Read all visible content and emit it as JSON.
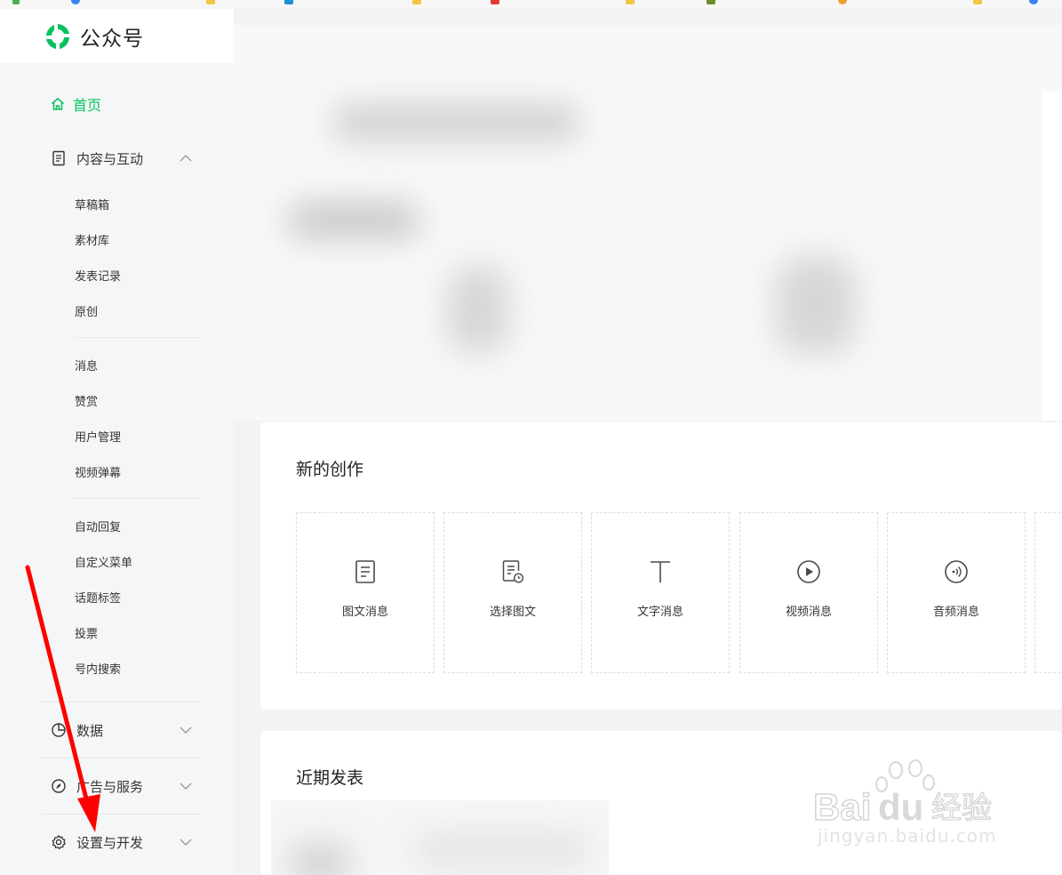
{
  "logo": {
    "text": "公众号",
    "brand_color": "#07c160"
  },
  "sidebar": {
    "home": {
      "label": "首页",
      "icon": "home-icon"
    },
    "content_group": {
      "label": "内容与互动",
      "icon": "document-icon",
      "expanded": true
    },
    "content_items_1": [
      "草稿箱",
      "素材库",
      "发表记录",
      "原创"
    ],
    "content_items_2": [
      "消息",
      "赞赏",
      "用户管理",
      "视频弹幕"
    ],
    "content_items_3": [
      "自动回复",
      "自定义菜单",
      "话题标签",
      "投票",
      "号内搜索"
    ],
    "data_group": {
      "label": "数据",
      "icon": "pie-chart-icon"
    },
    "ads_group": {
      "label": "广告与服务",
      "icon": "compass-icon"
    },
    "settings_group": {
      "label": "设置与开发",
      "icon": "gear-icon"
    }
  },
  "create": {
    "title": "新的创作",
    "tiles": [
      {
        "label": "图文消息",
        "icon": "article-icon"
      },
      {
        "label": "选择图文",
        "icon": "article-clock-icon"
      },
      {
        "label": "文字消息",
        "icon": "text-icon"
      },
      {
        "label": "视频消息",
        "icon": "play-icon"
      },
      {
        "label": "音频消息",
        "icon": "audio-icon"
      }
    ]
  },
  "recent": {
    "title": "近期发表"
  },
  "watermark": {
    "brand": "Baidu经验",
    "site": "jingyan.baidu.com"
  },
  "annotation_color": "#ff0000"
}
